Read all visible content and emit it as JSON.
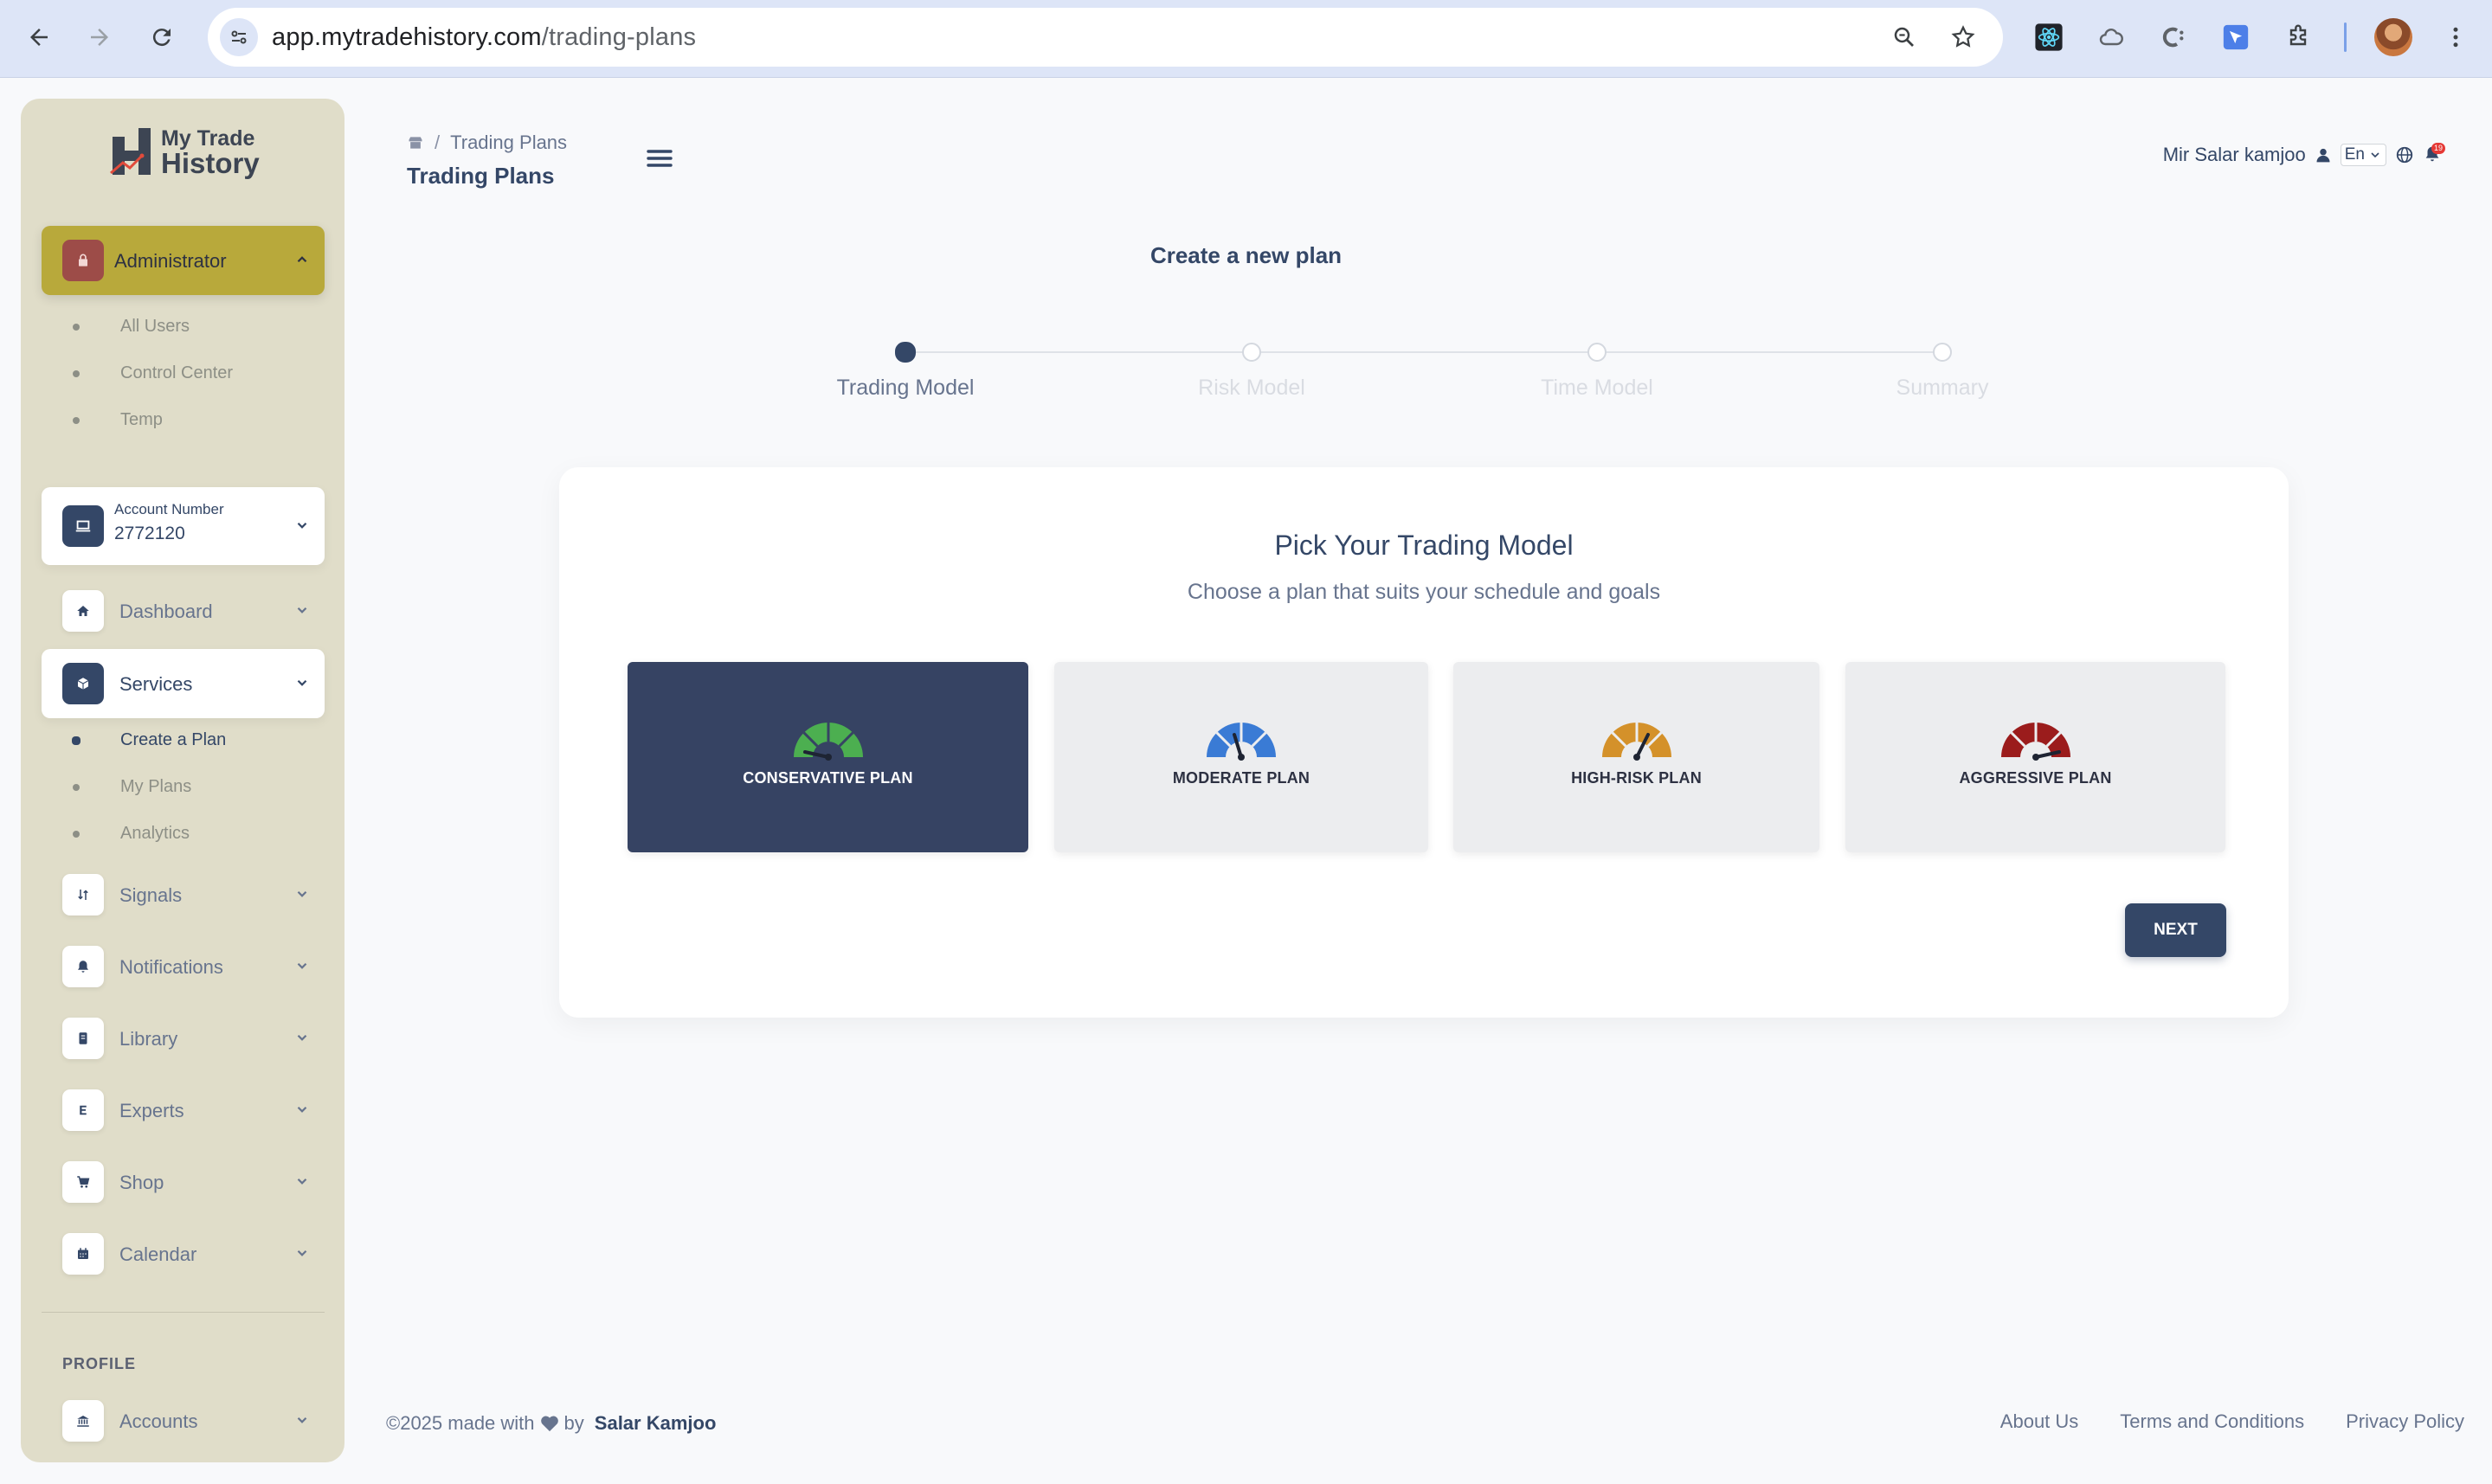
{
  "browser": {
    "url_host": "app.mytradehistory.com",
    "url_path": "/trading-plans"
  },
  "sidebar": {
    "logo": {
      "line1": "My Trade",
      "line2": "History"
    },
    "admin": {
      "label": "Administrator",
      "items": [
        "All Users",
        "Control Center",
        "Temp"
      ]
    },
    "account": {
      "label": "Account Number",
      "number": "2772120"
    },
    "nav": [
      {
        "label": "Dashboard",
        "icon": "home-icon"
      },
      {
        "label": "Services",
        "icon": "cube-icon"
      },
      {
        "label": "Signals",
        "icon": "arrows-icon"
      },
      {
        "label": "Notifications",
        "icon": "bell-icon"
      },
      {
        "label": "Library",
        "icon": "book-icon"
      },
      {
        "label": "Experts",
        "icon": "expert-icon"
      },
      {
        "label": "Shop",
        "icon": "cart-icon"
      },
      {
        "label": "Calendar",
        "icon": "calendar-icon"
      }
    ],
    "services_items": [
      "Create a Plan",
      "My Plans",
      "Analytics"
    ],
    "profile_heading": "PROFILE",
    "profile_items": [
      {
        "label": "Accounts",
        "icon": "bank-icon"
      }
    ]
  },
  "header": {
    "breadcrumb_current": "Trading Plans",
    "title": "Trading Plans",
    "user_name": "Mir Salar kamjoo",
    "language": "En",
    "notification_count": "19"
  },
  "wizard": {
    "title": "Create a new plan",
    "steps": [
      "Trading Model",
      "Risk Model",
      "Time Model",
      "Summary"
    ],
    "active_step": 0
  },
  "card": {
    "title": "Pick Your Trading Model",
    "subtitle": "Choose a plan that suits your schedule and goals",
    "plans": [
      {
        "name": "CONSERVATIVE PLAN",
        "color": "#4caf50",
        "selected": true
      },
      {
        "name": "MODERATE PLAN",
        "color": "#3a7bd5",
        "selected": false
      },
      {
        "name": "HIGH-RISK PLAN",
        "color": "#d4912a",
        "selected": false
      },
      {
        "name": "AGGRESSIVE PLAN",
        "color": "#9b1c1c",
        "selected": false
      }
    ],
    "next_label": "NEXT"
  },
  "footer": {
    "copyright": "©2025 made with",
    "by": "by",
    "author": "Salar Kamjoo",
    "links": [
      "About Us",
      "Terms and Conditions",
      "Privacy Policy"
    ]
  }
}
